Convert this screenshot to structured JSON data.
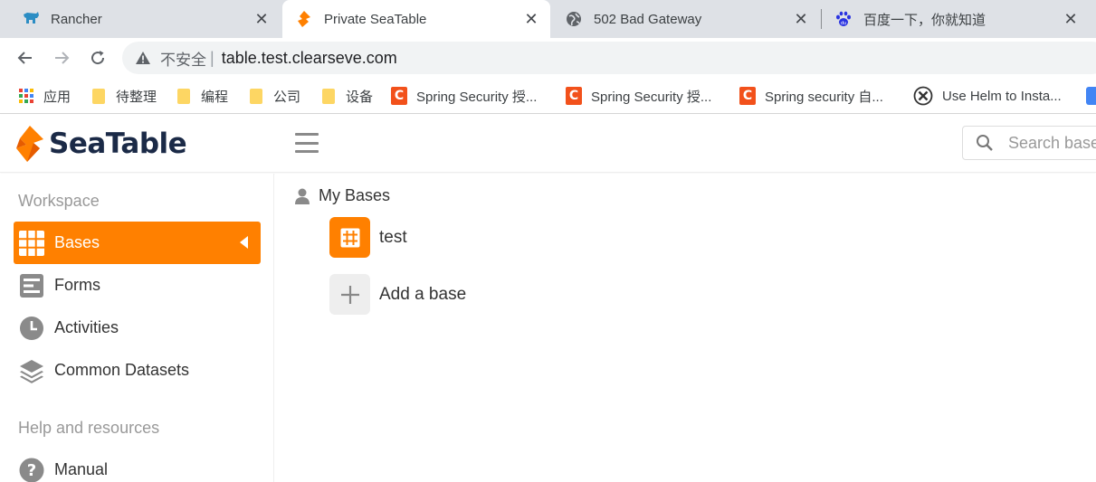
{
  "browser": {
    "tabs": [
      {
        "title": "Rancher",
        "icon": "rancher-icon",
        "active": false
      },
      {
        "title": "Private SeaTable",
        "icon": "seatable-icon",
        "active": true
      },
      {
        "title": "502 Bad Gateway",
        "icon": "globe-icon",
        "active": false
      },
      {
        "title": "百度一下，你就知道",
        "icon": "baidu-icon",
        "active": false
      }
    ],
    "close_glyph": "✕",
    "address": {
      "security_label": "不安全",
      "separator": "|",
      "url": "table.test.clearseve.com"
    },
    "bookmarks": [
      {
        "label": "应用",
        "icon": "apps-grid-icon"
      },
      {
        "label": "待整理",
        "icon": "folder-icon"
      },
      {
        "label": "编程",
        "icon": "folder-icon"
      },
      {
        "label": "公司",
        "icon": "folder-icon"
      },
      {
        "label": "设备",
        "icon": "folder-icon"
      },
      {
        "label": "Spring Security 授...",
        "icon": "csdn-icon"
      },
      {
        "label": "Spring Security 授...",
        "icon": "csdn-icon"
      },
      {
        "label": "Spring security 自...",
        "icon": "csdn-icon"
      },
      {
        "label": "Use Helm to Insta...",
        "icon": "helm-icon"
      }
    ],
    "csdn_letter": "C"
  },
  "app": {
    "logo_text": "SeaTable",
    "search_placeholder": "Search bases",
    "accent_color": "#ff8000",
    "sidebar": {
      "workspace_heading": "Workspace",
      "items": [
        {
          "label": "Bases",
          "icon": "grid-icon",
          "active": true
        },
        {
          "label": "Forms",
          "icon": "form-icon",
          "active": false
        },
        {
          "label": "Activities",
          "icon": "clock-icon",
          "active": false
        },
        {
          "label": "Common Datasets",
          "icon": "layers-icon",
          "active": false
        }
      ],
      "help_heading": "Help and resources",
      "help_items": [
        {
          "label": "Manual",
          "icon": "help-circle-icon"
        }
      ]
    },
    "main": {
      "section_title": "My Bases",
      "bases": [
        {
          "name": "test",
          "color": "#ff8000"
        }
      ],
      "add_label": "Add a base"
    }
  }
}
